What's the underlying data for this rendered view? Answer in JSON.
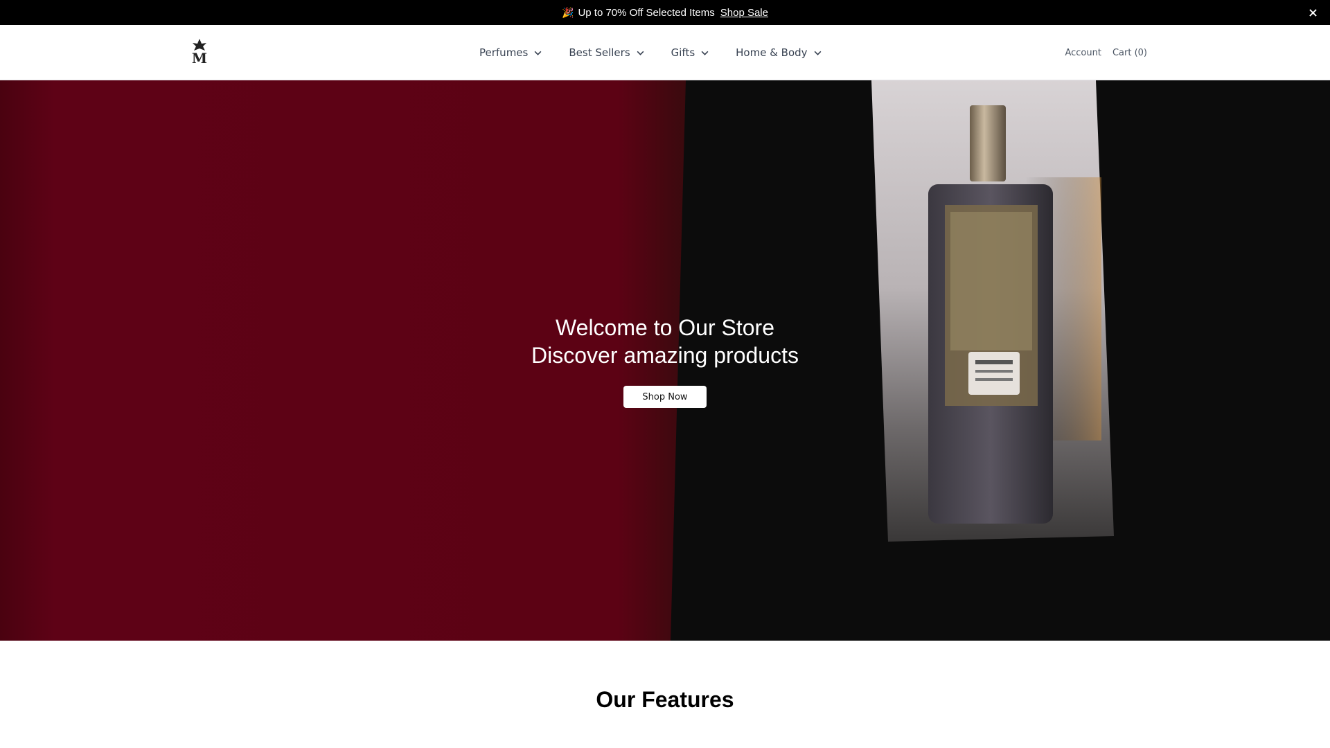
{
  "announcement": {
    "emoji": "🎉",
    "text": "Up to 70% Off Selected Items",
    "link_label": "Shop Sale",
    "close_icon": "close-icon"
  },
  "header": {
    "logo_icon": "brand-logo-icon",
    "nav": [
      {
        "label": "Perfumes",
        "icon": "chevron-down-icon"
      },
      {
        "label": "Best Sellers",
        "icon": "chevron-down-icon"
      },
      {
        "label": "Gifts",
        "icon": "chevron-down-icon"
      },
      {
        "label": "Home & Body",
        "icon": "chevron-down-icon"
      }
    ],
    "account_label": "Account",
    "cart_label": "Cart (0)"
  },
  "hero": {
    "title_line1": "Welcome to Our Store",
    "title_line2": "Discover amazing products",
    "button_label": "Shop Now",
    "colors": {
      "left_panel": "#5c0214",
      "right_panel": "#0c0c0c"
    }
  },
  "features": {
    "title": "Our Features"
  }
}
